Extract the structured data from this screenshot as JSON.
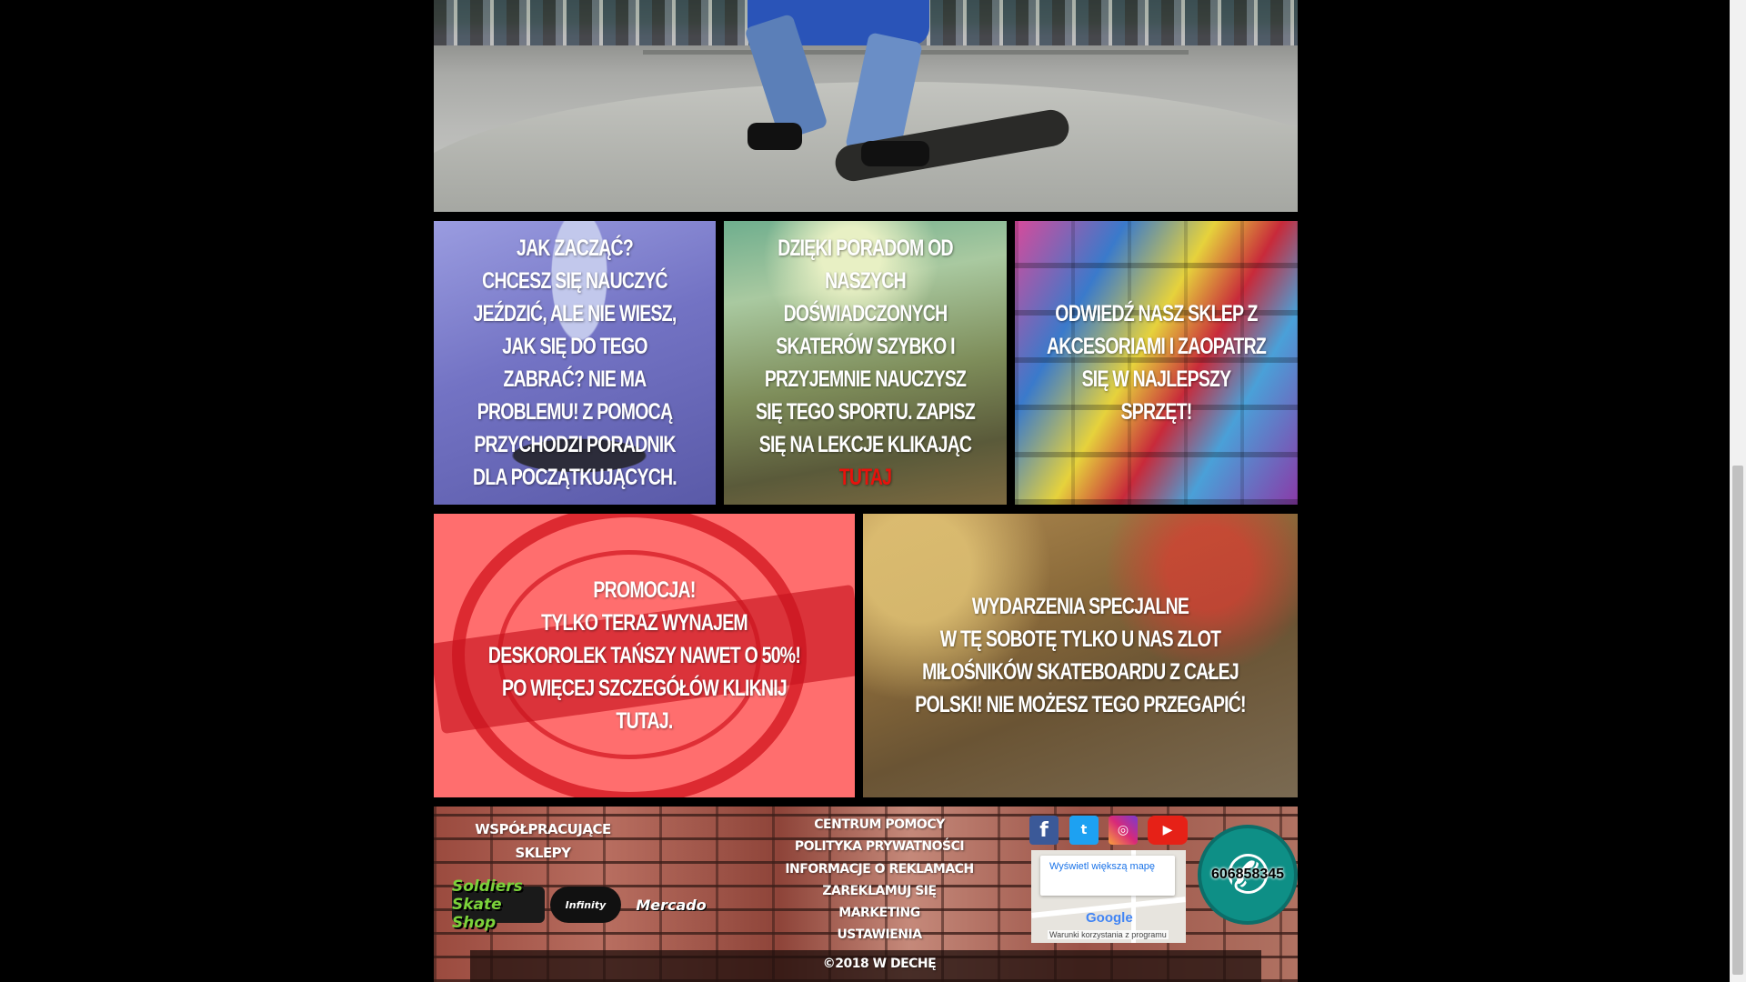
{
  "tiles": [
    {
      "lines": [
        "JAK ZACZĄĆ?",
        "CHCESZ SIĘ NAUCZYĆ JEŹDZIĆ, ALE NIE WIESZ, JAK SIĘ DO TEGO ZABRAĆ? NIE MA PROBLEMU! Z POMOCĄ PRZYCHODZI PORADNIK DLA POCZĄTKUJĄCYCH."
      ]
    },
    {
      "text": "DZIĘKI PORADOM OD NASZYCH DOŚWIADCZONYCH SKATERÓW SZYBKO I PRZYJEMNIE NAUCZYSZ SIĘ TEGO SPORTU. ZAPISZ SIĘ NA LEKCJE KLIKAJĄC ",
      "link": "TUTAJ"
    },
    {
      "text": "ODWIEDŹ NASZ SKLEP Z AKCESORIAMI I ZAOPATRZ SIĘ W NAJLEPSZY SPRZĘT!"
    },
    {
      "lines": [
        "PROMOCJA!",
        "TYLKO TERAZ WYNAJEM DESKOROLEK TAŃSZY NAWET O 50%!",
        "PO WIĘCEJ SZCZEGÓŁÓW KLIKNIJ TUTAJ."
      ]
    },
    {
      "lines": [
        "WYDARZENIA SPECJALNE",
        "W TĘ SOBOTĘ TYLKO U NAS ZLOT MIŁOŚNIKÓW SKATEBOARDU Z CAŁEJ POLSKI! NIE MOŻESZ TEGO PRZEGAPIĆ!"
      ]
    }
  ],
  "footer": {
    "partners_title": "WSPÓŁPRACUJĄCE SKLEPY",
    "partner_logos": [
      "Soldiers Skate Shop",
      "Infinity",
      "Mercado"
    ],
    "menu": [
      "CENTRUM POMOCY",
      "POLITYKA PRYWATNOŚCI",
      "INFORMACJE O REKLAMACH",
      "ZAREKLAMUJ SIĘ",
      "MARKETING",
      "USTAWIENIA"
    ],
    "copyright": "©2018 W DECHĘ",
    "social": {
      "facebook": "f",
      "twitter": "t",
      "instagram": "◎",
      "youtube": "▶"
    },
    "map": {
      "button": "Wyświetl większą mapę",
      "brand": "Google",
      "terms": "Warunki korzystania z programu"
    },
    "phone": {
      "number": "606858345",
      "icon": "phone-icon"
    }
  },
  "colors": {
    "link_red": "#e8120c",
    "phone_bg": "#0e8f86"
  }
}
